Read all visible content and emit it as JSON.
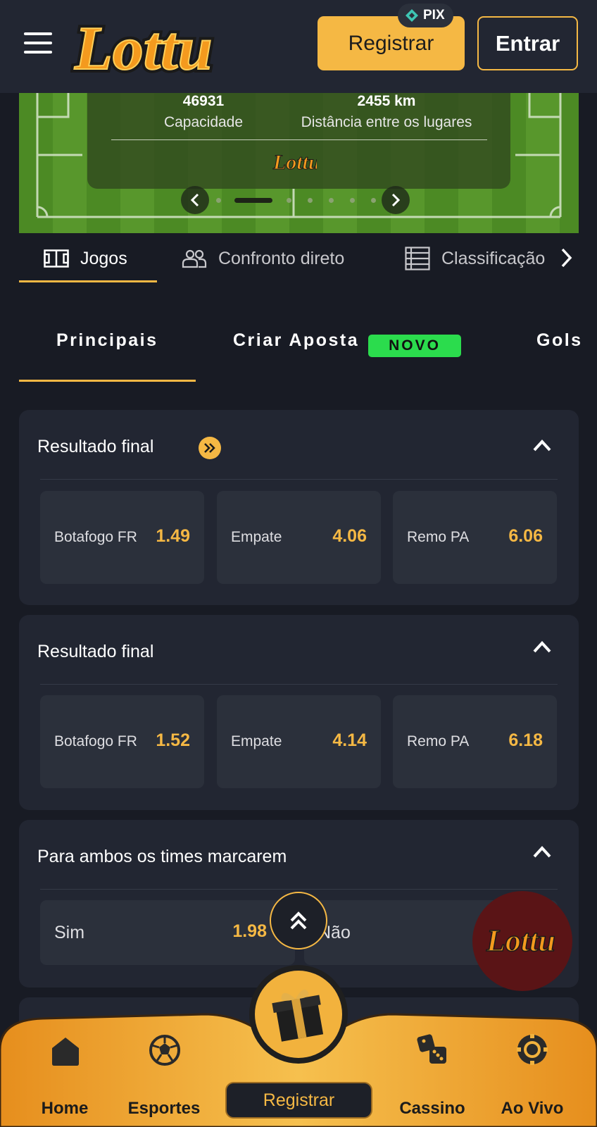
{
  "header": {
    "register_label": "Registrar",
    "login_label": "Entrar",
    "pix_label": "PIX",
    "brand": "Lottu"
  },
  "banner": {
    "capacity_value": "46931",
    "capacity_label": "Capacidade",
    "distance_value": "2455 km",
    "distance_label": "Distância entre os lugares",
    "carousel_total_dots": 8,
    "carousel_active_index": 1
  },
  "tabs_main": [
    {
      "label": "Jogos",
      "icon": "field-icon",
      "active": true
    },
    {
      "label": "Confronto direto",
      "icon": "users-icon",
      "active": false
    },
    {
      "label": "Classificação",
      "icon": "list-icon",
      "active": false
    }
  ],
  "tabs_markets": [
    {
      "label": "Principais",
      "active": true
    },
    {
      "label": "Criar Aposta",
      "badge": "NOVO",
      "active": false
    },
    {
      "label": "Gols",
      "active": false
    }
  ],
  "markets": [
    {
      "title": "Resultado final",
      "has_boost_icon": true,
      "odds": [
        {
          "name": "Botafogo FR",
          "price": "1.49"
        },
        {
          "name": "Empate",
          "price": "4.06"
        },
        {
          "name": "Remo PA",
          "price": "6.06"
        }
      ]
    },
    {
      "title": "Resultado final",
      "has_boost_icon": false,
      "odds": [
        {
          "name": "Botafogo FR",
          "price": "1.52"
        },
        {
          "name": "Empate",
          "price": "4.14"
        },
        {
          "name": "Remo PA",
          "price": "6.18"
        }
      ]
    },
    {
      "title": "Para ambos os times marcarem",
      "odds": [
        {
          "name": "Sim",
          "price": "1.98"
        },
        {
          "name": "Não",
          "price": ""
        }
      ]
    }
  ],
  "bottom_nav": {
    "home": "Home",
    "sports": "Esportes",
    "register": "Registrar",
    "casino": "Cassino",
    "live": "Ao Vivo"
  },
  "colors": {
    "accent": "#f5b844",
    "background": "#181b24",
    "card": "#222632",
    "odd_cell": "#2b303b",
    "novo_badge": "#2bdc4d"
  }
}
